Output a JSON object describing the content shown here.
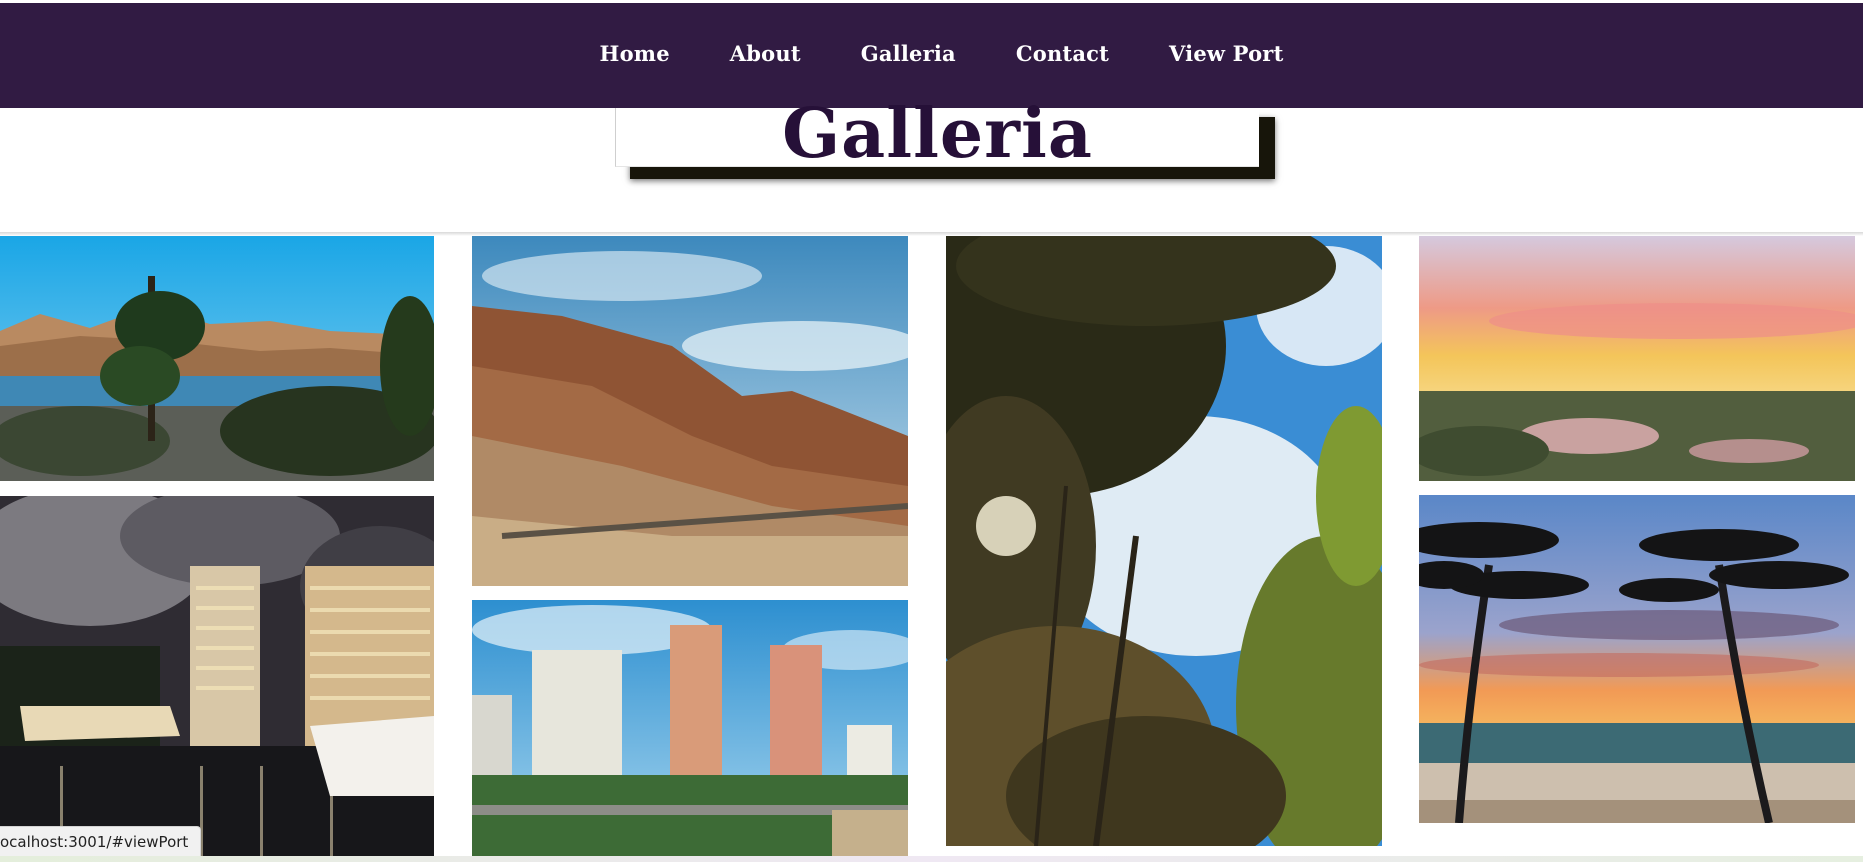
{
  "nav": {
    "items": [
      {
        "label": "Home"
      },
      {
        "label": "About"
      },
      {
        "label": "Galleria"
      },
      {
        "label": "Contact"
      },
      {
        "label": "View Port"
      }
    ]
  },
  "header": {
    "title": "Galleria"
  },
  "gallery": {
    "images": [
      {
        "name": "lake-mountains-photo"
      },
      {
        "name": "city-marina-night-photo"
      },
      {
        "name": "red-rock-cliffs-photo"
      },
      {
        "name": "beach-towers-photo"
      },
      {
        "name": "trees-sky-upward-photo"
      },
      {
        "name": "sunset-aerial-photo"
      },
      {
        "name": "palm-trees-beach-sunset-photo"
      }
    ]
  },
  "status": {
    "url": "ocalhost:3001/#viewPort"
  },
  "colors": {
    "nav_bg": "#311b43",
    "title_text": "#261038",
    "title_shadow": "#17150a"
  }
}
